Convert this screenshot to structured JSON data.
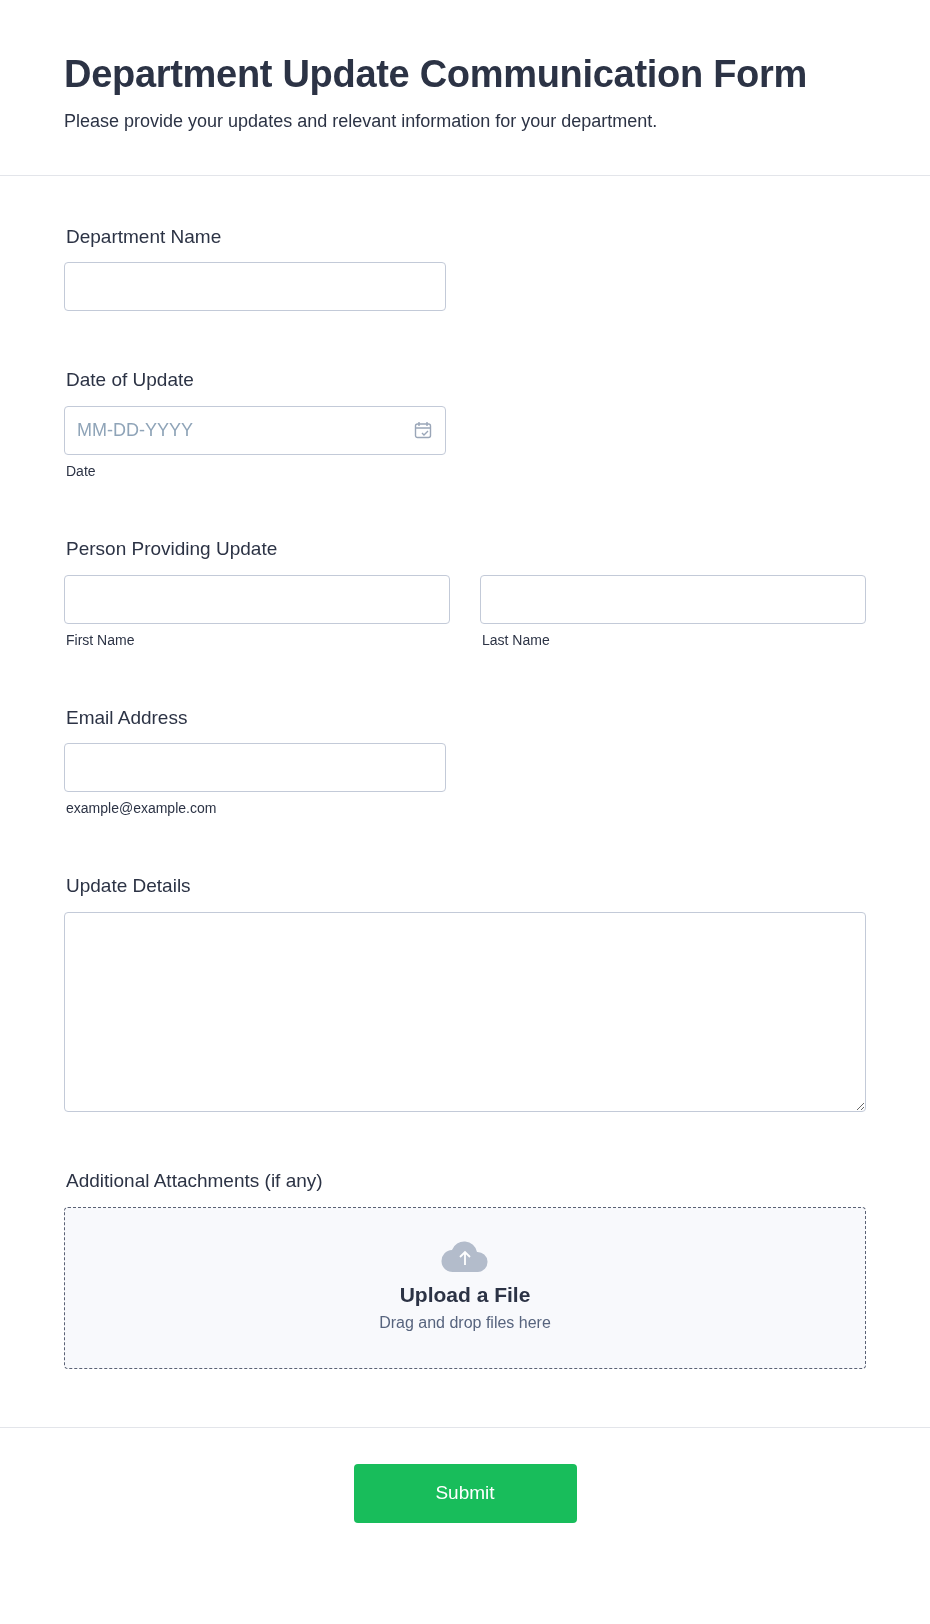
{
  "title": "Department Update Communication Form",
  "subtitle": "Please provide your updates and relevant information for your department.",
  "fields": [
    {
      "kind": "text",
      "label": "Department Name"
    },
    {
      "kind": "date",
      "label": "Date of Update",
      "placeholder": "MM-DD-YYYY",
      "sublabel": "Date"
    },
    {
      "kind": "name",
      "label": "Person Providing Update",
      "sublabels": [
        "First Name",
        "Last Name"
      ]
    },
    {
      "kind": "email",
      "label": "Email Address",
      "sublabel": "example@example.com"
    },
    {
      "kind": "textarea",
      "label": "Update Details"
    },
    {
      "kind": "file",
      "label": "Additional Attachments (if any)",
      "upload_title": "Upload a File",
      "upload_hint": "Drag and drop files here"
    }
  ],
  "submit": "Submit"
}
